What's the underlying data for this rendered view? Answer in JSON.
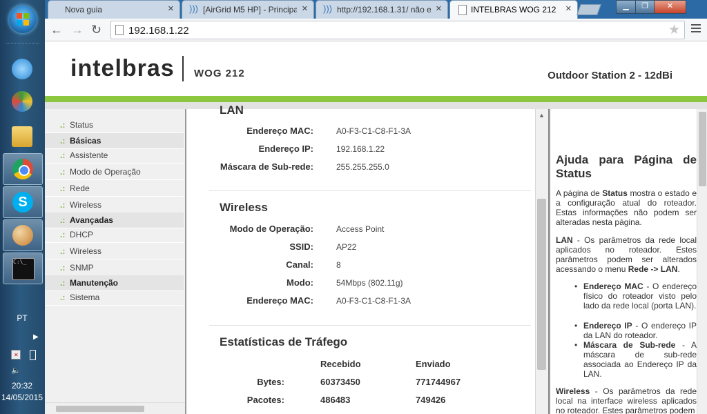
{
  "taskbar": {
    "apps": [
      {
        "name": "internet-explorer-icon",
        "color": "#2b8ad6"
      },
      {
        "name": "media-center-icon",
        "color": "#3b9c3c"
      },
      {
        "name": "file-explorer-icon",
        "color": "#e6b93c"
      },
      {
        "name": "chrome-icon",
        "color": "#dd4b39"
      },
      {
        "name": "skype-icon",
        "color": "#00aff0"
      },
      {
        "name": "paint-icon",
        "color": "#c77d2e"
      },
      {
        "name": "cmd-icon",
        "color": "#111111"
      }
    ],
    "language": "PT",
    "time": "20:32",
    "date": "14/05/2015"
  },
  "browser": {
    "tabs": [
      {
        "title": "Nova guia",
        "active": false
      },
      {
        "title": "[AirGrid M5 HP] - Principa",
        "active": false
      },
      {
        "title": "http://192.168.1.31/ não e",
        "active": false
      },
      {
        "title": "INTELBRAS WOG 212",
        "active": true
      }
    ],
    "url": "192.168.1.22"
  },
  "header": {
    "logo": "intelbras",
    "model": "WOG 212",
    "station": "Outdoor Station 2 - 12dBi"
  },
  "menu": {
    "items": [
      {
        "label": "Status",
        "section": false
      },
      {
        "label": "Básicas",
        "section": true
      },
      {
        "label": "Assistente",
        "section": false
      },
      {
        "label": "Modo de Operação",
        "section": false
      },
      {
        "label": "Rede",
        "section": false
      },
      {
        "label": "Wireless",
        "section": false
      },
      {
        "label": "Avançadas",
        "section": true
      },
      {
        "label": "DHCP",
        "section": false
      },
      {
        "label": "Wireless",
        "section": false
      },
      {
        "label": "SNMP",
        "section": false
      },
      {
        "label": "Manutenção",
        "section": true
      },
      {
        "label": "Sistema",
        "section": false
      }
    ],
    "bullet": ".:"
  },
  "main": {
    "lan": {
      "title": "LAN",
      "mac_label": "Endereço MAC:",
      "mac": "A0-F3-C1-C8-F1-3A",
      "ip_label": "Endereço IP:",
      "ip": "192.168.1.22",
      "mask_label": "Máscara de Sub-rede:",
      "mask": "255.255.255.0"
    },
    "wireless": {
      "title": "Wireless",
      "mode_label": "Modo de Operação:",
      "mode": "Access Point",
      "ssid_label": "SSID:",
      "ssid": "AP22",
      "channel_label": "Canal:",
      "channel": "8",
      "rate_label": "Modo:",
      "rate": "54Mbps (802.11g)",
      "mac_label": "Endereço MAC:",
      "mac": "A0-F3-C1-C8-F1-3A"
    },
    "traffic": {
      "title": "Estatísticas de Tráfego",
      "col_received": "Recebido",
      "col_sent": "Enviado",
      "rows": [
        {
          "label": "Bytes:",
          "received": "60373450",
          "sent": "771744967"
        },
        {
          "label": "Pacotes:",
          "received": "486483",
          "sent": "749426"
        }
      ]
    }
  },
  "help": {
    "title": "Ajuda para Página de Status",
    "p1_a": "A página de ",
    "p1_b": "Status",
    "p1_c": " mostra o estado e a configuração atual do roteador. Estas informações não podem ser alteradas nesta página.",
    "p2_a": "LAN",
    "p2_b": " - Os parâmetros da rede local aplicados no roteador. Estes parâmetros podem ser alterados acessando o menu ",
    "p2_c": "Rede -> LAN",
    "p2_d": ".",
    "li1_a": "Endereço MAC",
    "li1_b": " - O endereço físico do roteador visto pelo lado da rede local (porta LAN).",
    "li2_a": "Endereço IP",
    "li2_b": " - O endereço IP da LAN do roteador.",
    "li3_a": "Máscara de Sub-rede",
    "li3_b": " - A máscara de sub-rede associada ao Endereço IP da LAN.",
    "p3_a": "Wireless",
    "p3_b": " - Os parâmetros da rede local na interface wireless aplicados no roteador. Estes parâmetros podem"
  },
  "colors": {
    "brand_green": "#8dc63f",
    "tabstrip": "#2b6aa5"
  }
}
